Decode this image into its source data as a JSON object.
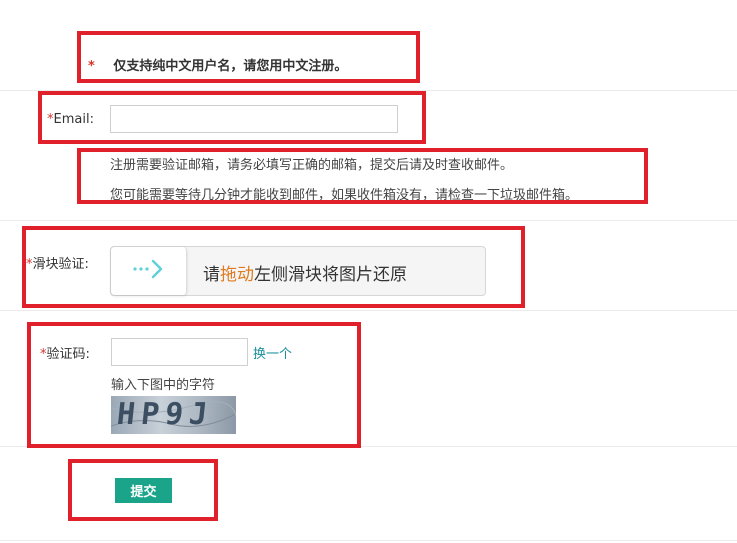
{
  "notice": {
    "star": "*",
    "text": "仅支持纯中文用户名，请您用中文注册。"
  },
  "email": {
    "star": "*",
    "label": "Email:",
    "value": "",
    "placeholder": ""
  },
  "email_hints": [
    "注册需要验证邮箱，请务必填写正确的邮箱，提交后请及时查收邮件。",
    "您可能需要等待几分钟才能收到邮件，如果收件箱没有，请检查一下垃圾邮件箱。"
  ],
  "slider": {
    "star": "*",
    "label": "滑块验证:",
    "text_prefix": "请",
    "text_highlight": "拖动",
    "text_suffix": "左侧滑块将图片还原",
    "handle_icon": "slider-arrow-icon"
  },
  "captcha": {
    "star": "*",
    "label": "验证码:",
    "value": "",
    "refresh_label": "换一个",
    "instruction": "输入下图中的字符",
    "image_text": "HP9J"
  },
  "submit": {
    "label": "提交"
  },
  "colors": {
    "accent": "#1aa58a",
    "required": "#d9332b",
    "highlight": "#e07a1f",
    "annotation_box": "#e0202a"
  }
}
